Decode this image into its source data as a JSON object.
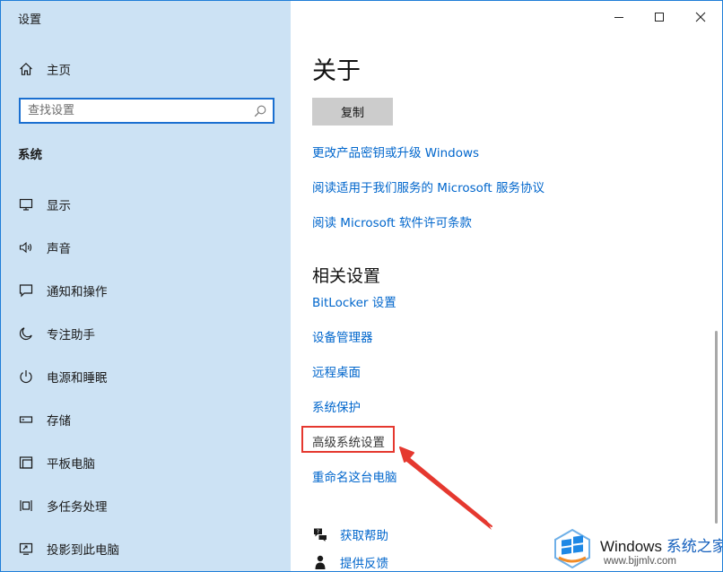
{
  "app_title": "设置",
  "window_controls": {
    "minimize": "minimize-icon",
    "maximize": "maximize-icon",
    "close": "close-icon"
  },
  "sidebar": {
    "home": {
      "label": "主页",
      "icon": "home-icon"
    },
    "search": {
      "placeholder": "查找设置",
      "value": "",
      "icon": "search-icon"
    },
    "section_title": "系统",
    "items": [
      {
        "label": "显示",
        "icon": "display-icon"
      },
      {
        "label": "声音",
        "icon": "sound-icon"
      },
      {
        "label": "通知和操作",
        "icon": "notification-icon"
      },
      {
        "label": "专注助手",
        "icon": "moon-icon"
      },
      {
        "label": "电源和睡眠",
        "icon": "power-icon"
      },
      {
        "label": "存储",
        "icon": "storage-icon"
      },
      {
        "label": "平板电脑",
        "icon": "tablet-icon"
      },
      {
        "label": "多任务处理",
        "icon": "multitask-icon"
      },
      {
        "label": "投影到此电脑",
        "icon": "project-icon"
      }
    ]
  },
  "main": {
    "title": "关于",
    "copy_button": "复制",
    "links": [
      "更改产品密钥或升级 Windows",
      "阅读适用于我们服务的 Microsoft 服务协议",
      "阅读 Microsoft 软件许可条款"
    ],
    "related_title": "相关设置",
    "related_links": [
      "BitLocker 设置",
      "设备管理器",
      "远程桌面",
      "系统保护",
      "高级系统设置",
      "重命名这台电脑"
    ],
    "help": [
      {
        "label": "获取帮助",
        "icon": "help-icon"
      },
      {
        "label": "提供反馈",
        "icon": "feedback-icon"
      }
    ]
  },
  "annotation": {
    "highlight_color": "#e5382f",
    "highlighted_item": "高级系统设置"
  },
  "watermark": {
    "brand_en": "Windows",
    "brand_zh": "系统之家",
    "url": "www.bjjmlv.com"
  },
  "colors": {
    "sidebar_bg": "#cce2f4",
    "link": "#0066cc",
    "accent": "#1a6fd0"
  }
}
